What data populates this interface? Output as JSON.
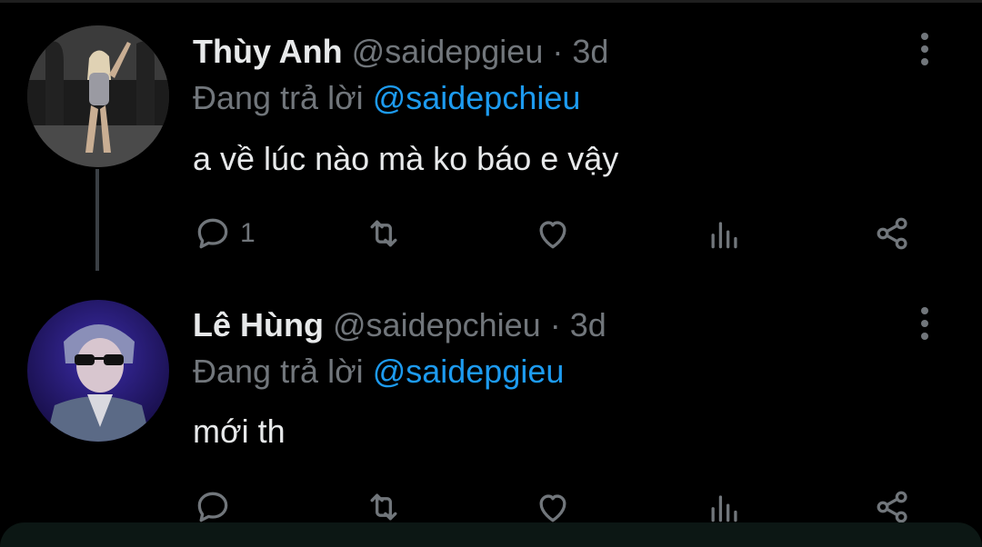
{
  "tweets": [
    {
      "name": "Thùy Anh",
      "handle": "@saidepgieu",
      "separator": "·",
      "time": "3d",
      "reply_prefix": "Đang trả lời",
      "reply_to": "@saidepchieu",
      "text": "a về lúc nào mà ko báo e vậy",
      "reply_count": "1"
    },
    {
      "name": "Lê Hùng",
      "handle": "@saidepchieu",
      "separator": "·",
      "time": "3d",
      "reply_prefix": "Đang trả lời",
      "reply_to": "@saidepgieu",
      "text": "mới th",
      "reply_count": ""
    }
  ],
  "colors": {
    "background": "#000000",
    "text_primary": "#e7e9ea",
    "text_secondary": "#71767b",
    "mention": "#1d9bf0"
  },
  "icons": [
    "reply-icon",
    "retweet-icon",
    "like-icon",
    "views-icon",
    "share-icon",
    "more-icon"
  ]
}
